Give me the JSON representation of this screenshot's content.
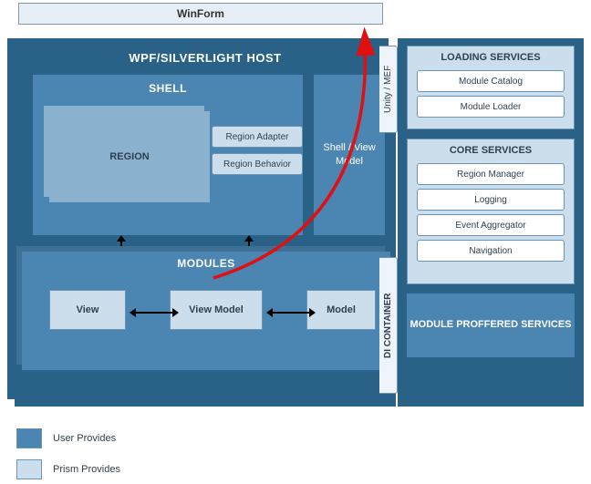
{
  "winform": {
    "title": "WinForm"
  },
  "host": {
    "title": "WPF/SILVERLIGHT HOST",
    "shell": {
      "title": "SHELL",
      "region": {
        "label": "REGION"
      },
      "region_adapter": "Region Adapter",
      "region_behavior": "Region Behavior"
    },
    "shell_viewmodel": "Shell / View Model"
  },
  "modules": {
    "title": "MODULES",
    "view": "View",
    "viewmodel": "View Model",
    "model": "Model"
  },
  "rightPanel": {
    "unity_tab": "Unity / MEF",
    "di_tab": "DI CONTAINER",
    "loading": {
      "title": "LOADING SERVICES",
      "items": [
        "Module Catalog",
        "Module Loader"
      ]
    },
    "core": {
      "title": "CORE SERVICES",
      "items": [
        "Region Manager",
        "Logging",
        "Event Aggregator",
        "Navigation"
      ]
    },
    "proffered": "MODULE PROFFERED SERVICES"
  },
  "legend": {
    "user": "User Provides",
    "prism": "Prism Provides"
  },
  "annotation": {
    "red_arrow": {
      "from": "View Model",
      "to": "WinForm",
      "color": "#e01010"
    }
  }
}
